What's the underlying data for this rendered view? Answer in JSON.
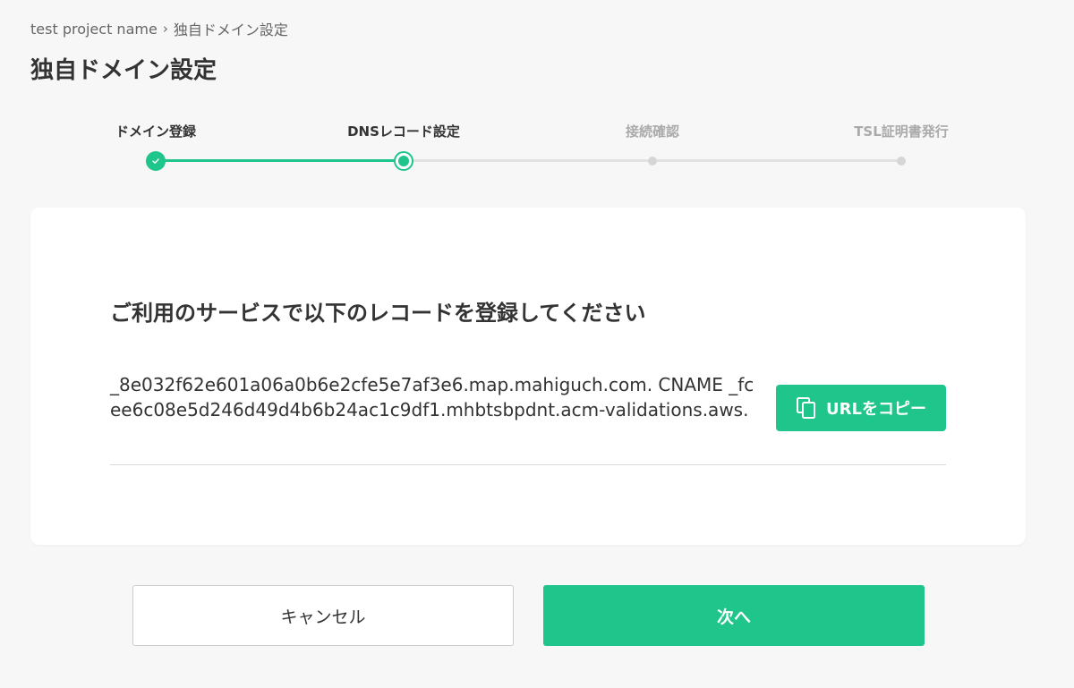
{
  "breadcrumb": {
    "project": "test project name",
    "separator": "›",
    "current": "独自ドメイン設定"
  },
  "page": {
    "title": "独自ドメイン設定"
  },
  "stepper": {
    "steps": [
      {
        "label": "ドメイン登録",
        "state": "completed"
      },
      {
        "label": "DNSレコード設定",
        "state": "current"
      },
      {
        "label": "接続確認",
        "state": "pending"
      },
      {
        "label": "TSL証明書発行",
        "state": "pending"
      }
    ],
    "accent_color": "#1fc58a"
  },
  "card": {
    "heading": "ご利用のサービスで以下のレコードを登録してください",
    "record": "_8e032f62e601a06a0b6e2cfe5e7af3e6.map.mahiguch.com. CNAME _fcee6c08e5d246d49d4b6b24ac1c9df1.mhbtsbpdnt.acm-validations.aws.",
    "copy_label": "URLをコピー",
    "copy_icon": "copy-icon"
  },
  "actions": {
    "cancel_label": "キャンセル",
    "next_label": "次へ"
  }
}
